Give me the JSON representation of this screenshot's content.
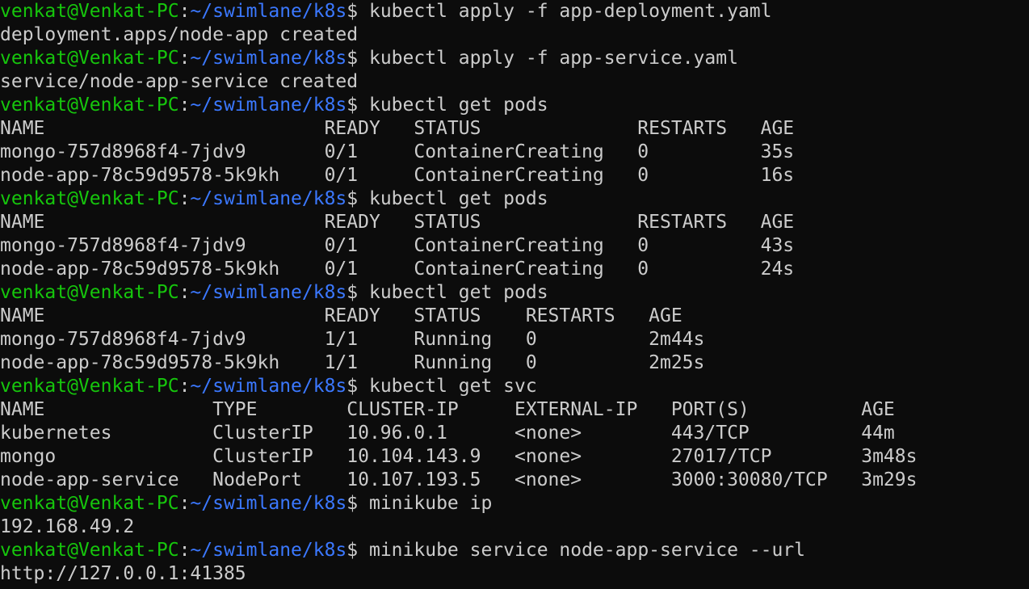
{
  "terminal": {
    "colors": {
      "background": "#0c0c0c",
      "foreground": "#cccccc",
      "prompt_user": "#16c60c",
      "prompt_path": "#3b78ff"
    },
    "lines": [
      {
        "type": "prompt",
        "user": "venkat@Venkat-PC",
        "sep": ":",
        "path": "~/swimlane/k8s",
        "tail": "$ kubectl apply -f app-deployment.yaml"
      },
      {
        "type": "output",
        "text": "deployment.apps/node-app created"
      },
      {
        "type": "prompt",
        "user": "venkat@Venkat-PC",
        "sep": ":",
        "path": "~/swimlane/k8s",
        "tail": "$ kubectl apply -f app-service.yaml"
      },
      {
        "type": "output",
        "text": "service/node-app-service created"
      },
      {
        "type": "prompt",
        "user": "venkat@Venkat-PC",
        "sep": ":",
        "path": "~/swimlane/k8s",
        "tail": "$ kubectl get pods"
      },
      {
        "type": "output",
        "text": "NAME                         READY   STATUS              RESTARTS   AGE"
      },
      {
        "type": "output",
        "text": "mongo-757d8968f4-7jdv9       0/1     ContainerCreating   0          35s"
      },
      {
        "type": "output",
        "text": "node-app-78c59d9578-5k9kh    0/1     ContainerCreating   0          16s"
      },
      {
        "type": "prompt",
        "user": "venkat@Venkat-PC",
        "sep": ":",
        "path": "~/swimlane/k8s",
        "tail": "$ kubectl get pods"
      },
      {
        "type": "output",
        "text": "NAME                         READY   STATUS              RESTARTS   AGE"
      },
      {
        "type": "output",
        "text": "mongo-757d8968f4-7jdv9       0/1     ContainerCreating   0          43s"
      },
      {
        "type": "output",
        "text": "node-app-78c59d9578-5k9kh    0/1     ContainerCreating   0          24s"
      },
      {
        "type": "prompt",
        "user": "venkat@Venkat-PC",
        "sep": ":",
        "path": "~/swimlane/k8s",
        "tail": "$ kubectl get pods"
      },
      {
        "type": "output",
        "text": "NAME                         READY   STATUS    RESTARTS   AGE"
      },
      {
        "type": "output",
        "text": "mongo-757d8968f4-7jdv9       1/1     Running   0          2m44s"
      },
      {
        "type": "output",
        "text": "node-app-78c59d9578-5k9kh    1/1     Running   0          2m25s"
      },
      {
        "type": "prompt",
        "user": "venkat@Venkat-PC",
        "sep": ":",
        "path": "~/swimlane/k8s",
        "tail": "$ kubectl get svc"
      },
      {
        "type": "output",
        "text": "NAME               TYPE        CLUSTER-IP     EXTERNAL-IP   PORT(S)          AGE"
      },
      {
        "type": "output",
        "text": "kubernetes         ClusterIP   10.96.0.1      <none>        443/TCP          44m"
      },
      {
        "type": "output",
        "text": "mongo              ClusterIP   10.104.143.9   <none>        27017/TCP        3m48s"
      },
      {
        "type": "output",
        "text": "node-app-service   NodePort    10.107.193.5   <none>        3000:30080/TCP   3m29s"
      },
      {
        "type": "prompt",
        "user": "venkat@Venkat-PC",
        "sep": ":",
        "path": "~/swimlane/k8s",
        "tail": "$ minikube ip"
      },
      {
        "type": "output",
        "text": "192.168.49.2"
      },
      {
        "type": "prompt",
        "user": "venkat@Venkat-PC",
        "sep": ":",
        "path": "~/swimlane/k8s",
        "tail": "$ minikube service node-app-service --url"
      },
      {
        "type": "output",
        "text": "http://127.0.0.1:41385"
      }
    ]
  }
}
